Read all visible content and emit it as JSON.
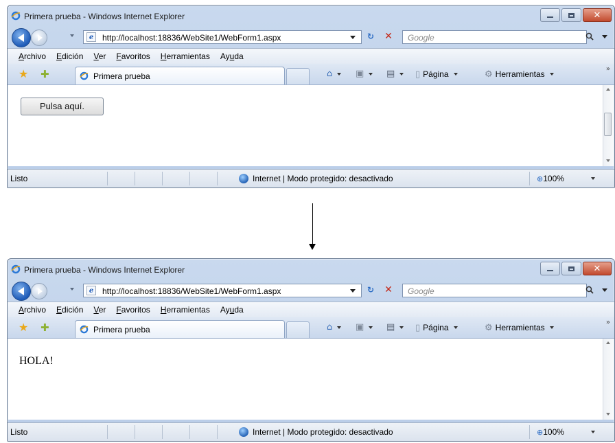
{
  "browser": {
    "window_title": "Primera prueba - Windows Internet Explorer",
    "address": "http://localhost:18836/WebSite1/WebForm1.aspx",
    "search_placeholder": "Google",
    "menu": [
      "Archivo",
      "Edición",
      "Ver",
      "Favoritos",
      "Herramientas",
      "Ayuda"
    ],
    "menu_underline": [
      "A",
      "E",
      "V",
      "F",
      "H",
      "u"
    ],
    "tab_title": "Primera prueba",
    "page_label": "Página",
    "tools_label": "Herramientas",
    "status_text": "Listo",
    "zone_text": "Internet | Modo protegido: desactivado",
    "zoom": "100%"
  },
  "before": {
    "button_label": "Pulsa aquí."
  },
  "after": {
    "page_text": "HOLA!"
  },
  "colors": {
    "accent": "#1e5bb8",
    "close_button": "#c24a2e"
  }
}
